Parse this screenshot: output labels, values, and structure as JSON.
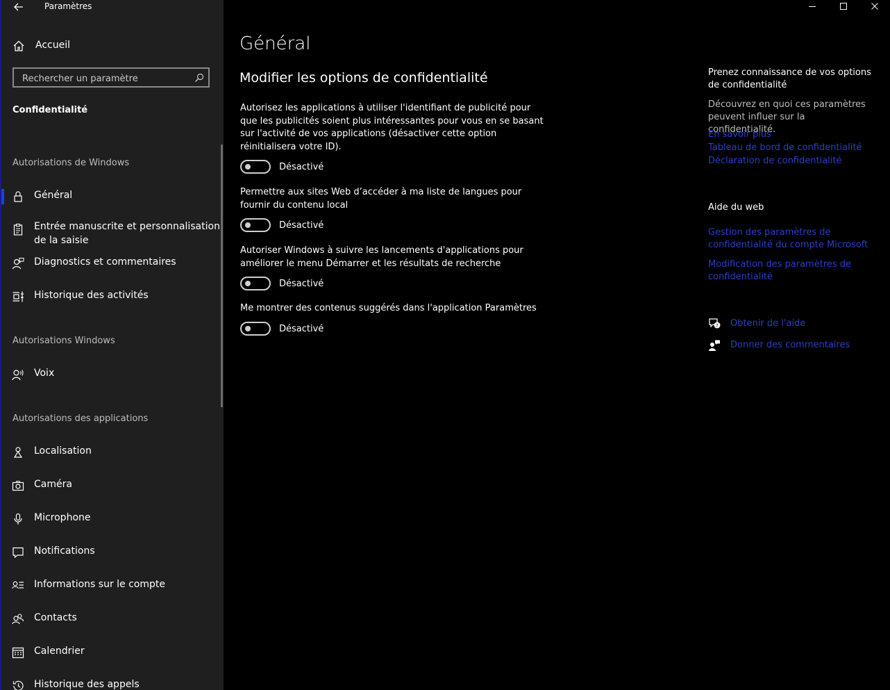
{
  "window": {
    "title": "Paramètres"
  },
  "sidebar": {
    "home_label": "Accueil",
    "search_placeholder": "Rechercher un paramètre",
    "section_title": "Confidentialité",
    "groups": [
      {
        "title": "Autorisations de Windows"
      },
      {
        "title": "Autorisations Windows"
      },
      {
        "title": "Autorisations des applications"
      }
    ],
    "items": [
      {
        "label": "Général",
        "icon": "lock-icon"
      },
      {
        "label": "Entrée manuscrite et personnalisation de la saisie",
        "icon": "clipboard-icon"
      },
      {
        "label": "Diagnostics et commentaires",
        "icon": "feedback-person-icon"
      },
      {
        "label": "Historique des activités",
        "icon": "timeline-icon"
      },
      {
        "label": "Voix",
        "icon": "speech-icon"
      },
      {
        "label": "Localisation",
        "icon": "location-icon"
      },
      {
        "label": "Caméra",
        "icon": "camera-icon"
      },
      {
        "label": "Microphone",
        "icon": "microphone-icon"
      },
      {
        "label": "Notifications",
        "icon": "notification-icon"
      },
      {
        "label": "Informations sur le compte",
        "icon": "account-info-icon"
      },
      {
        "label": "Contacts",
        "icon": "contacts-icon"
      },
      {
        "label": "Calendrier",
        "icon": "calendar-icon"
      },
      {
        "label": "Historique des appels",
        "icon": "call-history-icon"
      }
    ]
  },
  "main": {
    "title": "Général",
    "subtitle": "Modifier les options de confidentialité",
    "options": [
      {
        "text": "Autorisez les applications à utiliser l'identifiant de publicité pour que les publicités soient plus intéressantes pour vous en se basant sur l'activité de vos applications (désactiver cette option réinitialisera votre ID).",
        "state": "Désactivé",
        "on": false
      },
      {
        "text": "Permettre aux sites Web d’accéder à ma liste de langues pour fournir du contenu local",
        "state": "Désactivé",
        "on": false
      },
      {
        "text": "Autoriser Windows à suivre les lancements d'applications pour améliorer le menu Démarrer et les résultats de recherche",
        "state": "Désactivé",
        "on": false
      },
      {
        "text": "Me montrer des contenus suggérés dans l'application Paramètres",
        "state": "Désactivé",
        "on": false
      }
    ]
  },
  "aside": {
    "learn_heading": "Prenez connaissance de vos options de confidentialité",
    "learn_text": "Découvrez en quoi ces paramètres peuvent influer sur la confidentialité.",
    "learn_links": [
      "En savoir plus",
      "Tableau de bord de confidentialité",
      "Déclaration de confidentialité"
    ],
    "web_heading": "Aide du web",
    "web_links": [
      "Gestion des paramètres de confidentialité du compte Microsoft",
      "Modification des paramètres de confidentialité"
    ],
    "help_label": "Obtenir de l'aide",
    "feedback_label": "Donner des commentaires"
  },
  "colors": {
    "accent": "#1d3ee0",
    "link": "#2a3fc8",
    "sidebar_bg": "#1f1f1f",
    "main_bg": "#000000"
  }
}
